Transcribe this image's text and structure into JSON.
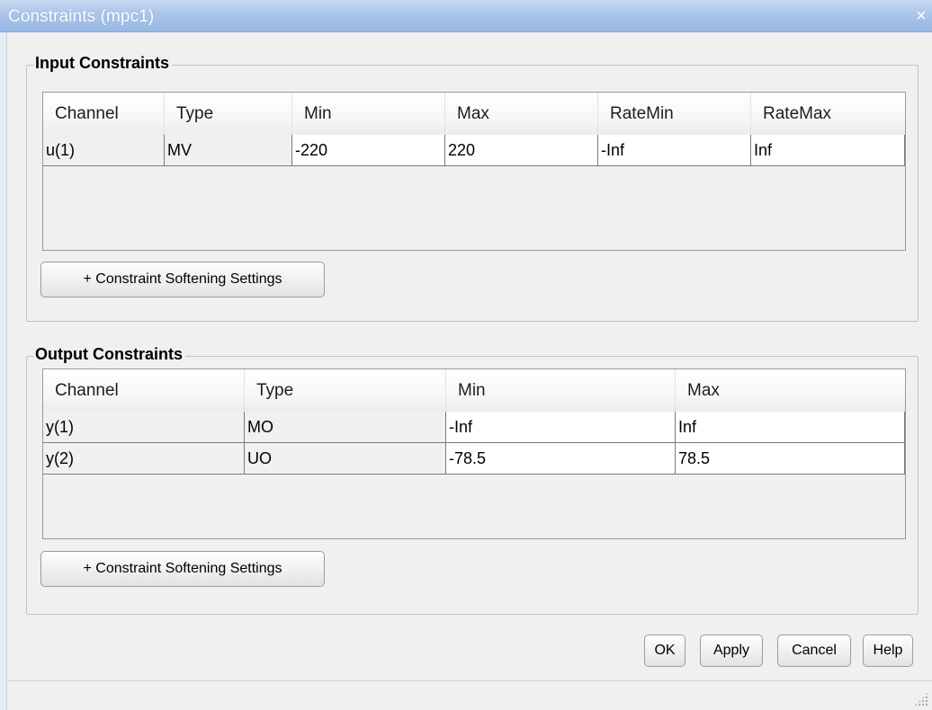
{
  "window": {
    "title": "Constraints (mpc1)",
    "close_glyph": "×"
  },
  "input_constraints": {
    "legend": "Input Constraints",
    "columns": [
      "Channel",
      "Type",
      "Min",
      "Max",
      "RateMin",
      "RateMax"
    ],
    "rows": [
      [
        "u(1)",
        "MV",
        "-220",
        "220",
        "-Inf",
        "Inf"
      ]
    ],
    "softening_button": "+ Constraint Softening Settings"
  },
  "output_constraints": {
    "legend": "Output Constraints",
    "columns": [
      "Channel",
      "Type",
      "Min",
      "Max"
    ],
    "rows": [
      [
        "y(1)",
        "MO",
        "-Inf",
        "Inf"
      ],
      [
        "y(2)",
        "UO",
        "-78.5",
        "78.5"
      ]
    ],
    "softening_button": "+ Constraint Softening Settings"
  },
  "buttons": {
    "ok": "OK",
    "apply": "Apply",
    "cancel": "Cancel",
    "help": "Help"
  },
  "icons": {
    "close": "close-icon",
    "resize": "resize-grip-icon"
  },
  "colors": {
    "titlebar": "#a9c5ea",
    "window_bg": "#f0f0f0",
    "cell_bg": "#ffffff"
  }
}
